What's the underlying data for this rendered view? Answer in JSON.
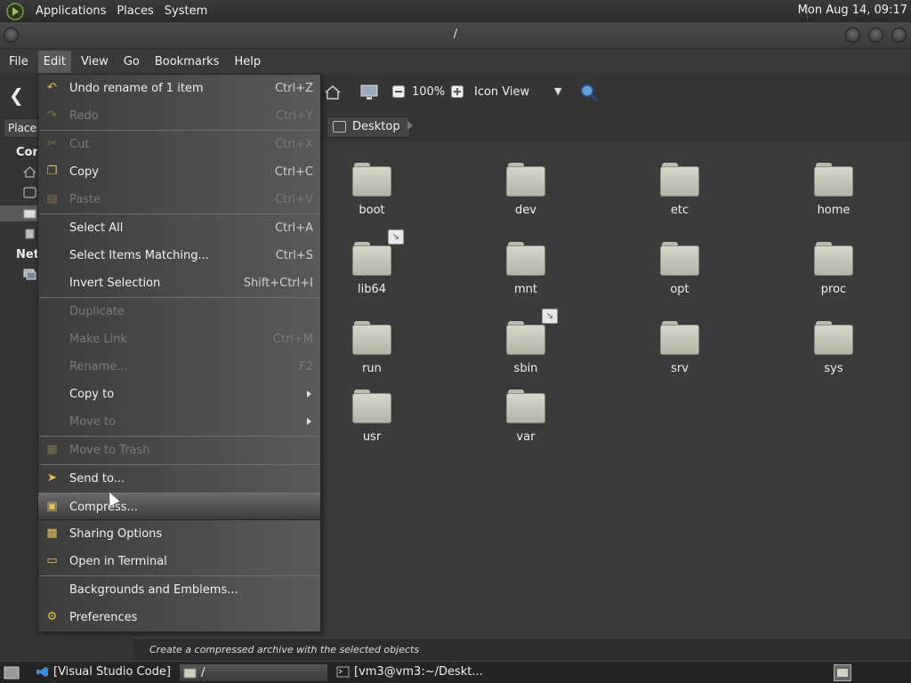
{
  "top_panel": {
    "menus": [
      "Applications",
      "Places",
      "System"
    ],
    "clock": "Mon Aug 14, 09:17"
  },
  "window": {
    "title": "/"
  },
  "menubar": {
    "items": [
      "File",
      "Edit",
      "View",
      "Go",
      "Bookmarks",
      "Help"
    ],
    "active": "Edit"
  },
  "toolbar": {
    "zoom": "100%",
    "view_mode": "Icon View"
  },
  "location": {
    "path_button": "Desktop"
  },
  "sidebar": {
    "places_button": "Places",
    "heading_computer": "Con",
    "heading_network": "Netw"
  },
  "edit_menu": [
    {
      "label": "Undo rename of 1 item",
      "accel": "Ctrl+Z",
      "enabled": true,
      "icon": "undo-icon"
    },
    {
      "label": "Redo",
      "accel": "Ctrl+Y",
      "enabled": false,
      "icon": "redo-icon"
    },
    {
      "label": "Cut",
      "accel": "Ctrl+X",
      "enabled": false,
      "icon": "scissors-icon"
    },
    {
      "label": "Copy",
      "accel": "Ctrl+C",
      "enabled": true,
      "icon": "copy-icon"
    },
    {
      "label": "Paste",
      "accel": "Ctrl+V",
      "enabled": false,
      "icon": "paste-icon"
    },
    {
      "label": "Select All",
      "accel": "Ctrl+A",
      "enabled": true
    },
    {
      "label": "Select Items Matching...",
      "accel": "Ctrl+S",
      "enabled": true
    },
    {
      "label": "Invert Selection",
      "accel": "Shift+Ctrl+I",
      "enabled": true
    },
    {
      "label": "Duplicate",
      "accel": "",
      "enabled": false
    },
    {
      "label": "Make Link",
      "accel": "Ctrl+M",
      "enabled": false
    },
    {
      "label": "Rename...",
      "accel": "F2",
      "enabled": false
    },
    {
      "label": "Copy to",
      "accel": "",
      "enabled": true,
      "submenu": true
    },
    {
      "label": "Move to",
      "accel": "",
      "enabled": false,
      "submenu": true
    },
    {
      "label": "Move to Trash",
      "accel": "",
      "enabled": false,
      "icon": "trash-icon"
    },
    {
      "label": "Send to...",
      "accel": "",
      "enabled": true,
      "icon": "send-icon"
    },
    {
      "label": "Compress...",
      "accel": "",
      "enabled": true,
      "icon": "archive-icon",
      "highlighted": true
    },
    {
      "label": "Sharing Options",
      "accel": "",
      "enabled": true,
      "icon": "folder-share-icon"
    },
    {
      "label": "Open in Terminal",
      "accel": "",
      "enabled": true,
      "icon": "terminal-icon"
    },
    {
      "label": "Backgrounds and Emblems...",
      "accel": "",
      "enabled": true
    },
    {
      "label": "Preferences",
      "accel": "",
      "enabled": true,
      "icon": "preferences-icon"
    }
  ],
  "folders": [
    {
      "name": "boot",
      "link": false
    },
    {
      "name": "dev",
      "link": false
    },
    {
      "name": "etc",
      "link": false
    },
    {
      "name": "home",
      "link": false
    },
    {
      "name": "lib64",
      "link": true
    },
    {
      "name": "mnt",
      "link": false
    },
    {
      "name": "opt",
      "link": false
    },
    {
      "name": "proc",
      "link": false
    },
    {
      "name": "run",
      "link": false
    },
    {
      "name": "sbin",
      "link": true
    },
    {
      "name": "srv",
      "link": false
    },
    {
      "name": "sys",
      "link": false
    },
    {
      "name": "usr",
      "link": false
    },
    {
      "name": "var",
      "link": false
    }
  ],
  "status": {
    "text": "Create a compressed archive with the selected objects"
  },
  "taskbar": {
    "tasks": [
      {
        "label": "[Visual Studio Code]",
        "active": false,
        "icon": "vscode-icon"
      },
      {
        "label": "/",
        "active": true,
        "icon": "folder-icon"
      },
      {
        "label": "[vm3@vm3:~/Deskt...",
        "active": false,
        "icon": "terminal-icon"
      }
    ]
  }
}
